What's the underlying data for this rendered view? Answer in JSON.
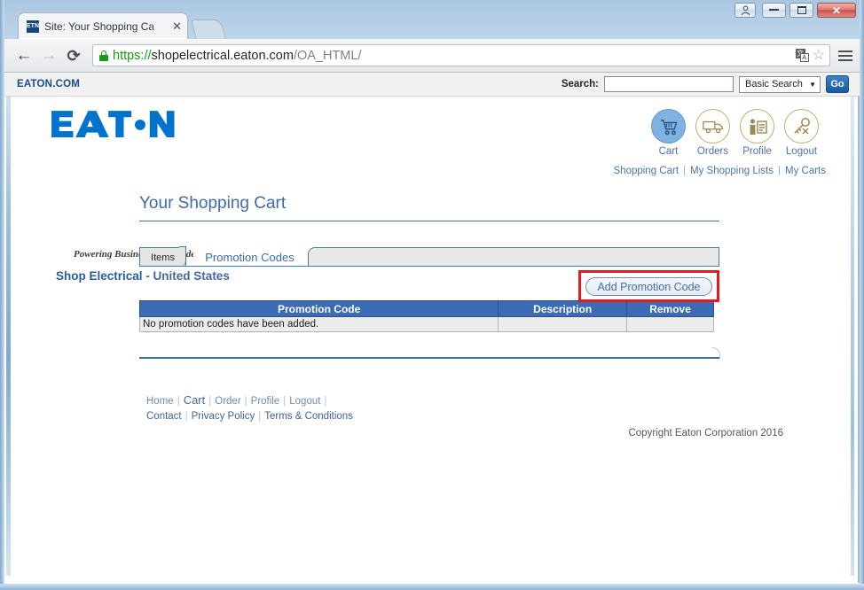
{
  "window": {
    "controls": {
      "user_label": "user-account",
      "minimize_label": "minimize",
      "maximize_label": "maximize",
      "close_label": "✕"
    }
  },
  "browser": {
    "tab": {
      "favicon_text": "ETN",
      "title": "Site:  Your Shopping Ca",
      "close_label": "✕"
    },
    "toolbar": {
      "back_label": "←",
      "forward_label": "→",
      "reload_label": "⟳",
      "url_scheme": "https://",
      "url_host": "shopelectrical.eaton.com",
      "url_path": "/OA_HTML/",
      "translate_a": "文",
      "translate_b": "A",
      "star_label": "☆"
    }
  },
  "utility_bar": {
    "eaton_com_label": "EATON.COM",
    "search_label": "Search:",
    "search_value": "",
    "search_placeholder": "",
    "search_type_selected": "Basic Search",
    "search_type_caret": "▼",
    "go_label": "Go"
  },
  "brand": {
    "logo_text": "EAT•N",
    "tagline": "Powering Business Worldwide",
    "shop_title": "Shop Electrical",
    "shop_title_sub": "- United States"
  },
  "icon_nav": [
    {
      "label": "Cart",
      "icon": "shopping-cart-icon",
      "active": true
    },
    {
      "label": "Orders",
      "icon": "delivery-truck-icon",
      "active": false
    },
    {
      "label": "Profile",
      "icon": "profile-badge-icon",
      "active": false
    },
    {
      "label": "Logout",
      "icon": "key-logout-icon",
      "active": false
    }
  ],
  "top_links": [
    {
      "label": "Shopping Cart"
    },
    {
      "label": "My Shopping Lists"
    },
    {
      "label": "My Carts"
    }
  ],
  "main": {
    "page_title": "Your Shopping Cart",
    "tabs": [
      {
        "label": "Items",
        "active": false
      },
      {
        "label": "Promotion Codes",
        "active": true
      }
    ],
    "add_promo_button": "Add Promotion Code",
    "table": {
      "headers": [
        "Promotion Code",
        "Description",
        "Remove"
      ],
      "rows": [
        [
          "No promotion codes have been added.",
          "",
          ""
        ]
      ]
    }
  },
  "footer": {
    "row1": [
      "Home",
      "Cart",
      "Order",
      "Profile",
      "Logout"
    ],
    "row2": [
      "Contact",
      "Privacy Policy",
      "Terms & Conditions"
    ],
    "copyright": "Copyright Eaton Corporation 2016"
  },
  "colors": {
    "eaton_blue": "#0073CF",
    "heading_blue": "#3d6ca8",
    "table_header_blue": "#3b6bb5",
    "highlight_red": "#e11b22",
    "link_blue": "#4a75ab"
  }
}
